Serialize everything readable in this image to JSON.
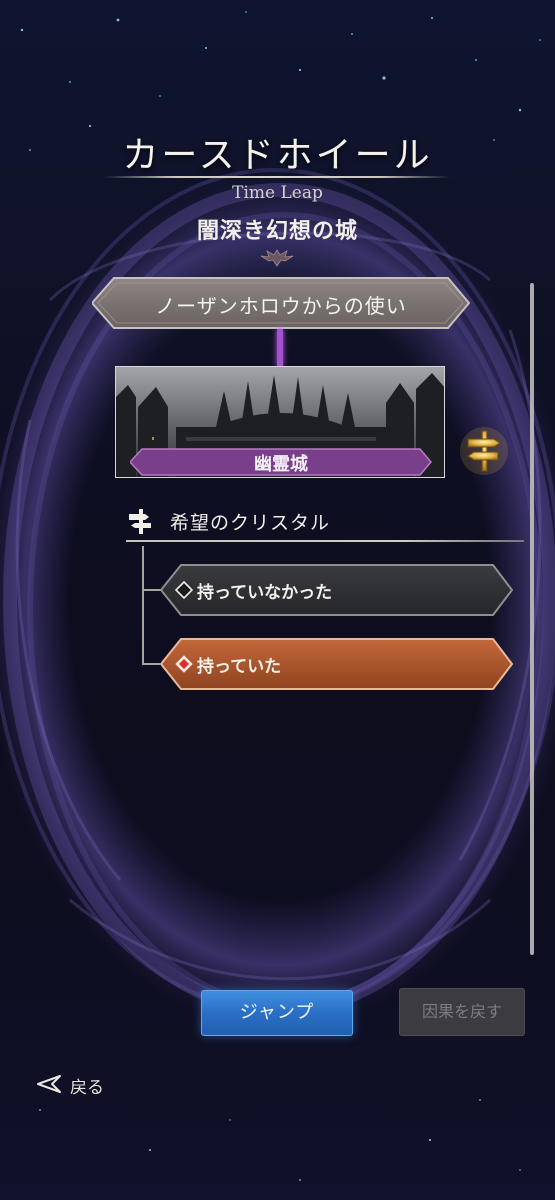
{
  "header": {
    "title": "カースドホイール",
    "subtitle": "Time Leap",
    "chapter": "闇深き幻想の城"
  },
  "timeline": {
    "event_banner": "ノーザンホロウからの使い",
    "location": "幽霊城"
  },
  "branch": {
    "title": "希望のクリスタル",
    "options": [
      {
        "label": "持っていなかった",
        "selected": false
      },
      {
        "label": "持っていた",
        "selected": true
      }
    ]
  },
  "buttons": {
    "jump": "ジャンプ",
    "revert": "因果を戻す",
    "back": "戻る"
  },
  "colors": {
    "accent_purple": "#a44ed0",
    "selected_option": "#b0552a",
    "jump_blue": "#2b6fc6"
  }
}
